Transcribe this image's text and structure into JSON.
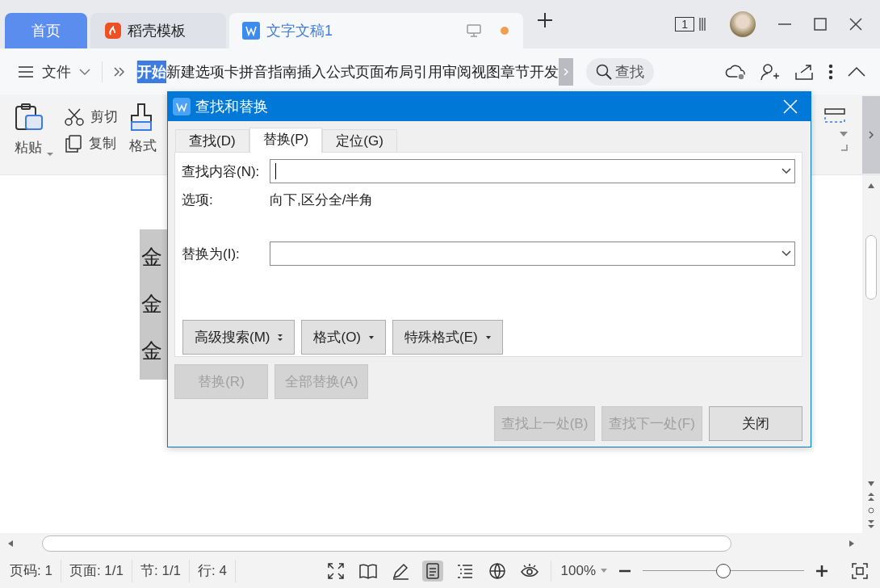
{
  "title_tabs": [
    {
      "label": "首页",
      "kind": "home",
      "selected": false
    },
    {
      "label": "稻壳模板",
      "kind": "docer",
      "selected": false
    },
    {
      "label": "文字文稿1",
      "kind": "doc",
      "selected": true,
      "modified": true
    }
  ],
  "window_controls": {
    "badge": "1"
  },
  "menu": {
    "file": "文件",
    "ribbon_tabs": [
      {
        "label": "开始",
        "selected": true
      },
      {
        "label": "新建选项卡",
        "selected": false
      },
      {
        "label": "拼音指南",
        "selected": false
      },
      {
        "label": "插入",
        "selected": false
      },
      {
        "label": "公式",
        "selected": false
      },
      {
        "label": "页面布局",
        "selected": false
      },
      {
        "label": "引用",
        "selected": false
      },
      {
        "label": "审阅",
        "selected": false
      },
      {
        "label": "视图",
        "selected": false
      },
      {
        "label": "章节",
        "selected": false
      },
      {
        "label": "开发",
        "selected": false
      }
    ],
    "search": "查找"
  },
  "ribbon": {
    "paste": "粘贴",
    "cut": "剪切",
    "copy": "复制",
    "format_painter": "格式"
  },
  "document": {
    "lines": [
      "金",
      "金",
      "金"
    ]
  },
  "dialog": {
    "title": "查找和替换",
    "tabs": [
      {
        "label": "查找(D)",
        "selected": false
      },
      {
        "label": "替换(P)",
        "selected": true
      },
      {
        "label": "定位(G)",
        "selected": false
      }
    ],
    "find_label": "查找内容(N):",
    "options_label": "选项:",
    "options_value": "向下,区分全/半角",
    "replace_label": "替换为(I):",
    "option_buttons": [
      {
        "label": "高级搜索(M)",
        "kind": "expand"
      },
      {
        "label": "格式(O)",
        "kind": "menu"
      },
      {
        "label": "特殊格式(E)",
        "kind": "menu"
      }
    ],
    "replace_buttons": [
      {
        "label": "替换(R)",
        "disabled": true
      },
      {
        "label": "全部替换(A)",
        "disabled": true
      }
    ],
    "bottom_buttons": [
      {
        "label": "查找上一处(B)",
        "disabled": true
      },
      {
        "label": "查找下一处(F)",
        "disabled": true
      },
      {
        "label": "关闭",
        "disabled": false
      }
    ]
  },
  "status_bar": {
    "items": [
      "页码: 1",
      "页面: 1/1",
      "节: 1/1",
      "行: 4"
    ],
    "views": [
      {
        "kind": "fullscreen",
        "selected": false
      },
      {
        "kind": "read",
        "selected": false
      },
      {
        "kind": "write",
        "selected": false
      },
      {
        "kind": "page",
        "selected": true
      },
      {
        "kind": "outline",
        "selected": false
      },
      {
        "kind": "web",
        "selected": false
      },
      {
        "kind": "eye",
        "selected": false
      }
    ],
    "zoom": "100%",
    "zoom_slider": {
      "level": 0.5
    }
  }
}
